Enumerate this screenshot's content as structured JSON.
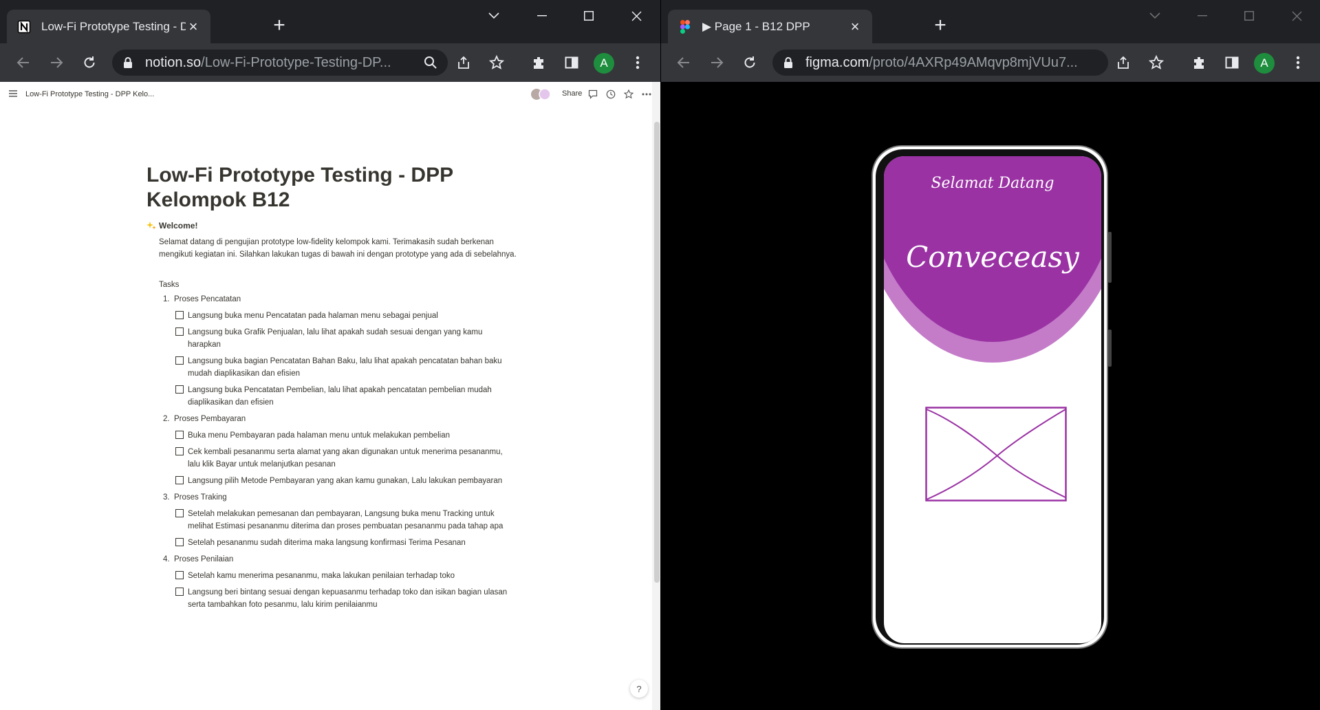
{
  "left_window": {
    "tab_title": "Low-Fi Prototype Testing - DPP K",
    "url_domain": "notion.so",
    "url_path": "/Low-Fi-Prototype-Testing-DP...",
    "avatar_letter": "A"
  },
  "right_window": {
    "tab_title": "▶ Page 1 - B12 DPP",
    "url_domain": "figma.com",
    "url_path": "/proto/4AXRp49AMqvp8mjVUu7...",
    "avatar_letter": "A"
  },
  "notion": {
    "breadcrumb": "Low-Fi Prototype Testing - DPP Kelo...",
    "share_label": "Share",
    "help_label": "?",
    "title": "Low-Fi Prototype Testing - DPP Kelompok B12",
    "welcome": "Welcome!",
    "intro": "Selamat datang di pengujian prototype low-fidelity kelompok kami. Terimakasih sudah berkenan mengikuti kegiatan ini. Silahkan lakukan tugas di bawah ini dengan prototype yang ada di sebelahnya.",
    "tasks_heading": "Tasks",
    "tasks": [
      {
        "num": "1.",
        "label": "Proses Pencatatan",
        "items": [
          "Langsung buka menu Pencatatan pada halaman menu sebagai penjual",
          "Langsung buka Grafik Penjualan, lalu lihat apakah sudah sesuai dengan yang kamu harapkan",
          "Langsung buka bagian Pencatatan Bahan Baku, lalu lihat apakah pencatatan bahan baku mudah diaplikasikan dan efisien",
          "Langsung buka Pencatatan Pembelian, lalu lihat apakah pencatatan pembelian mudah diaplikasikan dan efisien"
        ]
      },
      {
        "num": "2.",
        "label": "Proses Pembayaran",
        "items": [
          "Buka menu Pembayaran pada halaman menu untuk melakukan pembelian",
          "Cek kembali pesananmu serta alamat yang akan digunakan untuk menerima pesananmu, lalu klik Bayar untuk melanjutkan pesanan",
          "Langsung pilih Metode Pembayaran yang akan kamu gunakan, Lalu lakukan pembayaran"
        ]
      },
      {
        "num": "3.",
        "label": "Proses Traking",
        "items": [
          "Setelah melakukan pemesanan dan pembayaran, Langsung buka menu Tracking untuk melihat Estimasi pesananmu diterima dan proses pembuatan pesananmu pada tahap apa",
          "Setelah pesananmu sudah diterima maka langsung konfirmasi Terima Pesanan"
        ]
      },
      {
        "num": "4.",
        "label": "Proses Penilaian",
        "items": [
          "Setelah kamu menerima pesananmu, maka lakukan penilaian terhadap toko",
          "Langsung beri bintang sesuai dengan kepuasanmu terhadap toko dan isikan bagian ulasan serta tambahkan foto pesanmu, lalu kirim penilaianmu"
        ]
      }
    ]
  },
  "prototype": {
    "greeting": "Selamat Datang",
    "app_name": "Conveceasy",
    "colors": {
      "primary": "#9a32a4",
      "secondary": "#c47cc9"
    }
  }
}
